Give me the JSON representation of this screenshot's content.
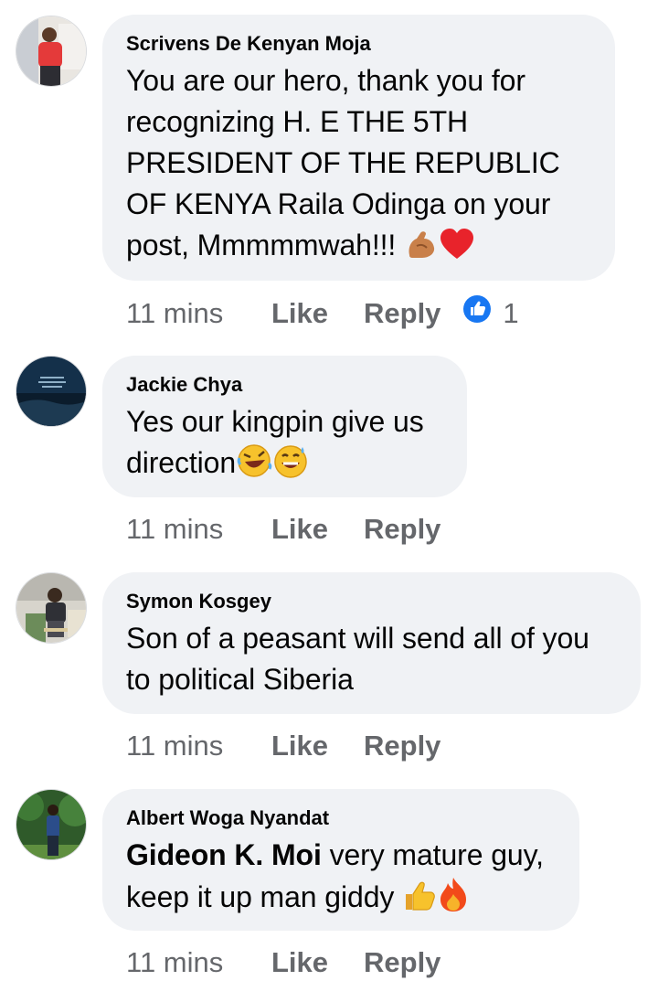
{
  "comments": [
    {
      "author": "Scrivens De Kenyan Moja",
      "text": "You are our hero, thank you for recognizing H. E THE 5TH PRESIDENT OF THE REPUBLIC OF KENYA Raila Odinga on your post, Mmmmmwah!!!",
      "time": "11 mins",
      "like": "Like",
      "reply": "Reply",
      "reaction_count": "1"
    },
    {
      "author": "Jackie Chya",
      "text": "Yes our kingpin give us direction",
      "time": "11 mins",
      "like": "Like",
      "reply": "Reply"
    },
    {
      "author": "Symon Kosgey",
      "text": "Son of a peasant will send all of you to political Siberia",
      "time": "11 mins",
      "like": "Like",
      "reply": "Reply"
    },
    {
      "author": "Albert Woga Nyandat",
      "mention": "Gideon K. Moi",
      "text": " very mature guy, keep it up man giddy",
      "time": "11 mins",
      "like": "Like",
      "reply": "Reply"
    }
  ],
  "icons": {
    "reaction": "like-reaction-icon",
    "emoji_1": [
      "flexed-biceps-icon",
      "red-heart-icon"
    ],
    "emoji_2": [
      "rolling-laughing-icon",
      "sweat-smile-icon"
    ],
    "emoji_4": [
      "thumbs-up-icon",
      "fire-icon"
    ]
  },
  "colors": {
    "bubble": "#f0f2f5",
    "meta_text": "#65676b",
    "like_blue": "#1877f2"
  }
}
